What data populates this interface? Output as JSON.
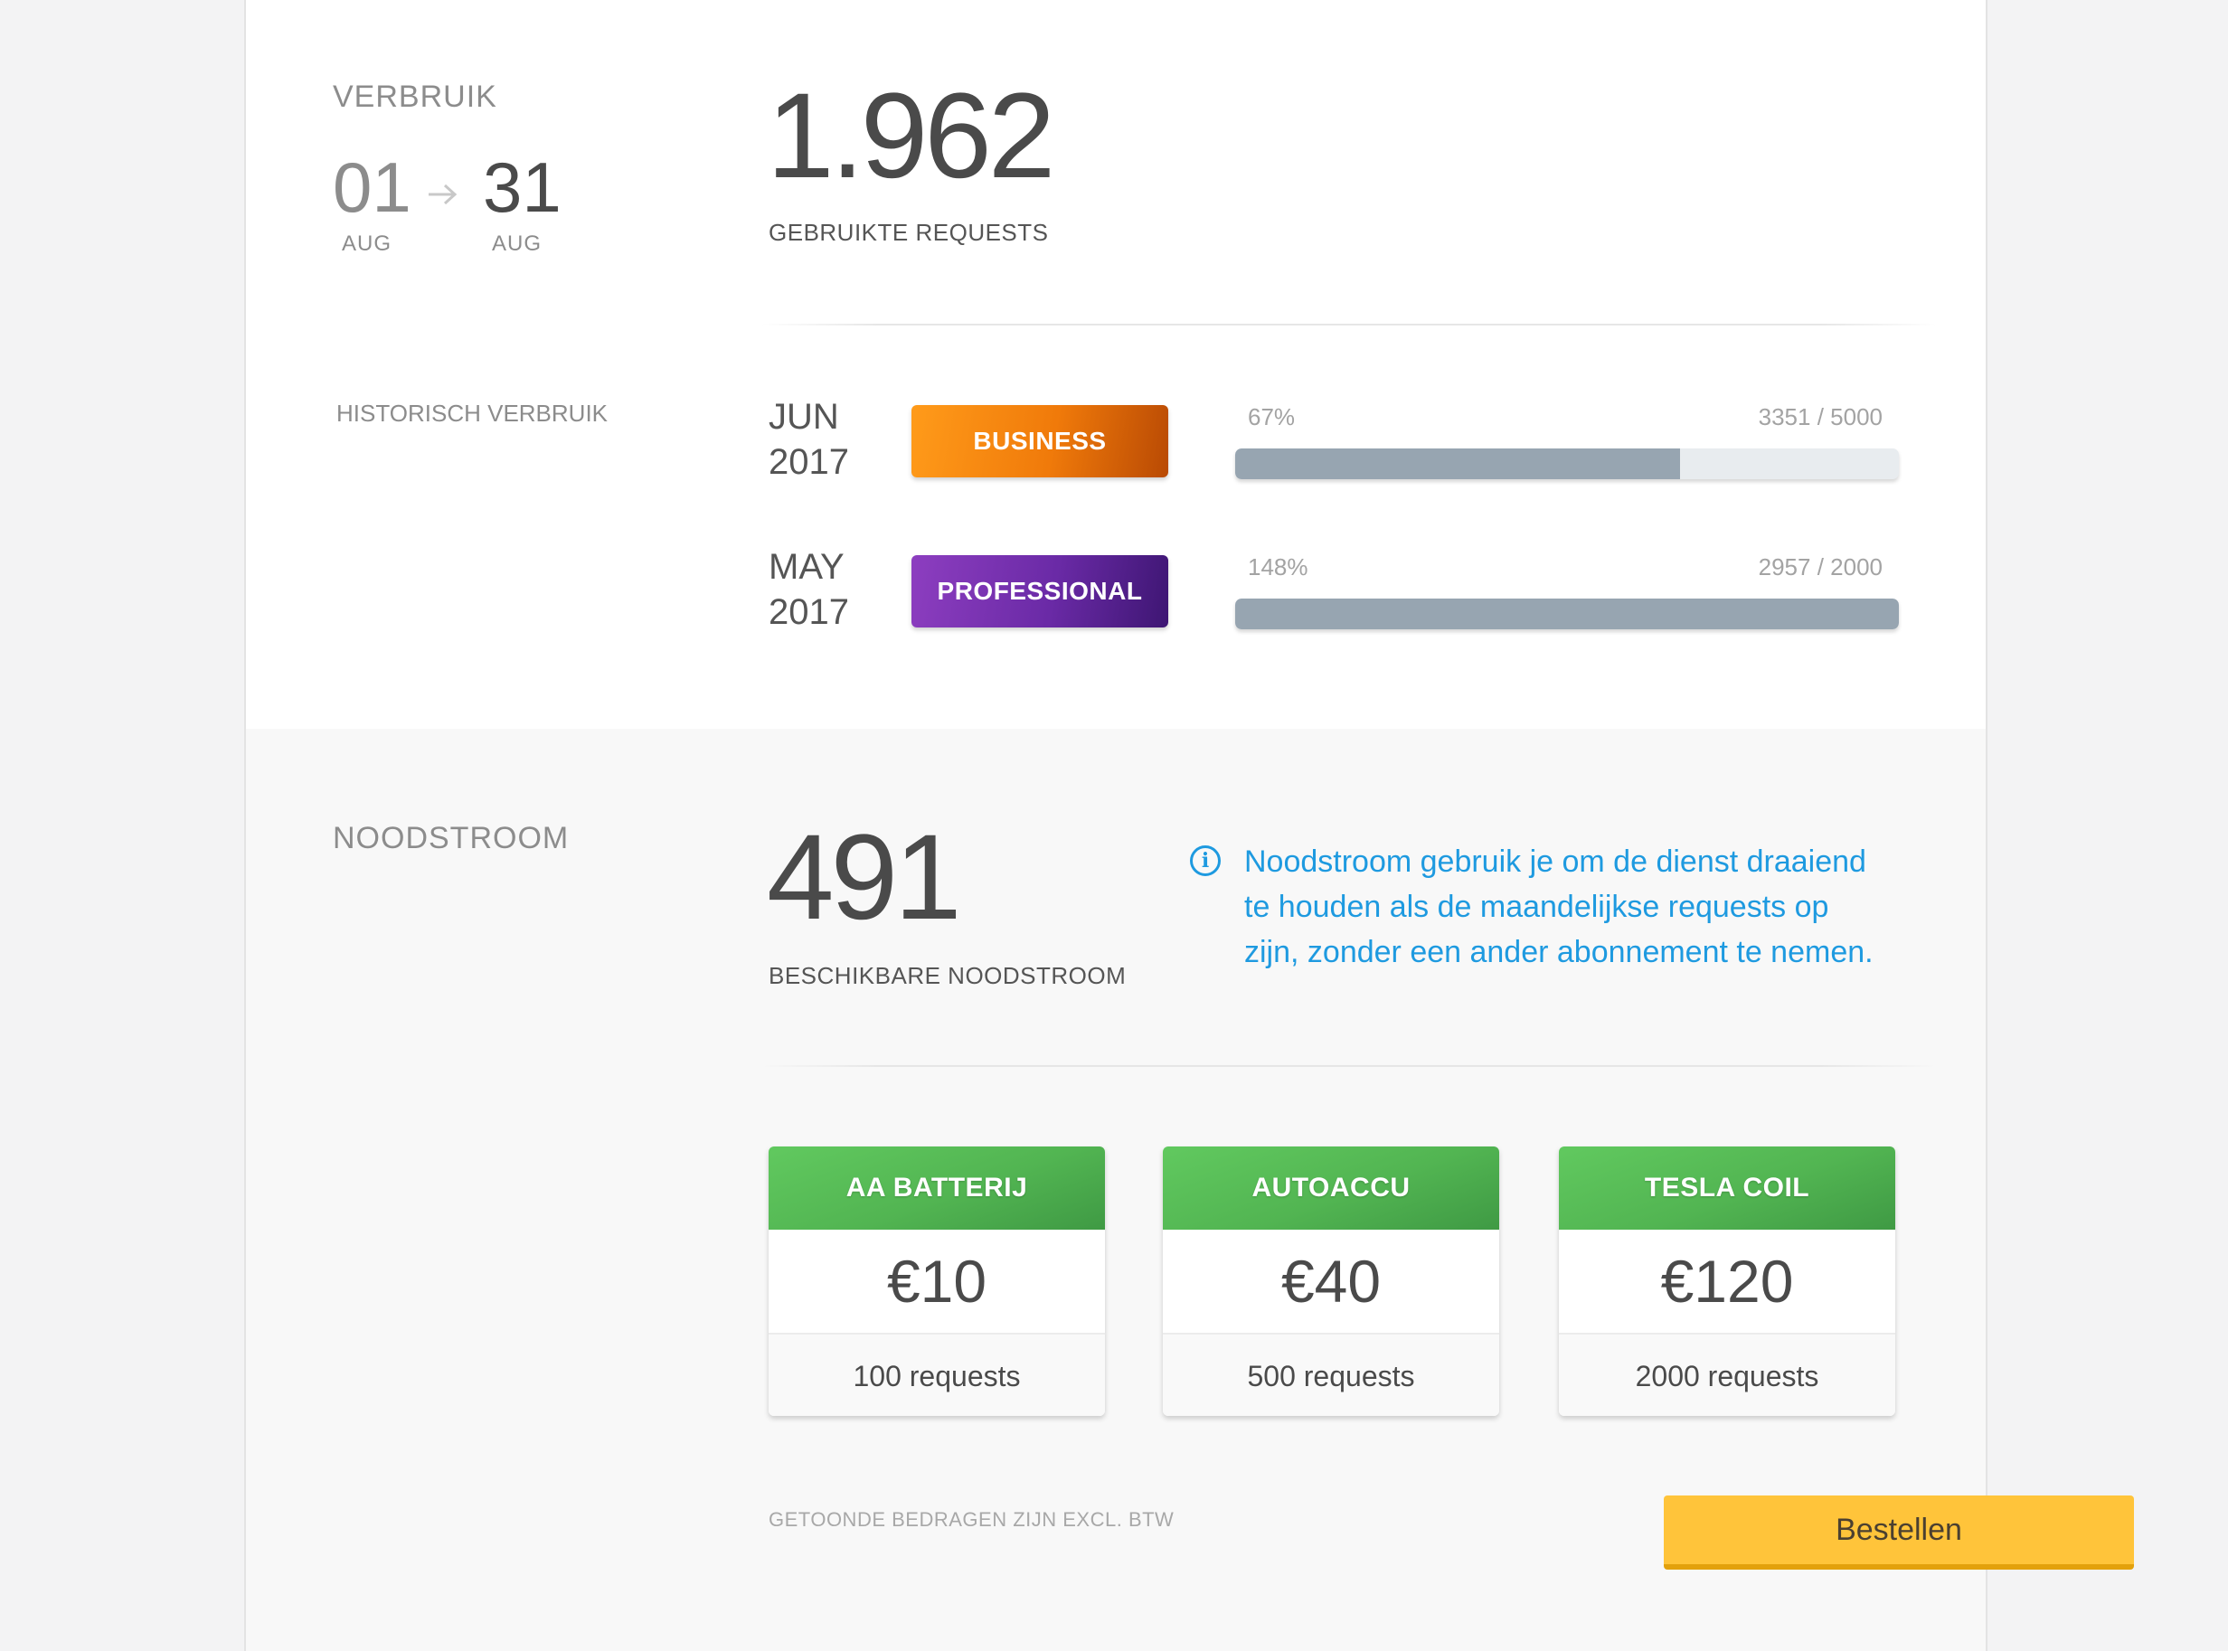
{
  "usage": {
    "section_title": "VERBRUIK",
    "period": {
      "start_day": "01",
      "start_month": "AUG",
      "end_day": "31",
      "end_month": "AUG"
    },
    "requests_used": "1.962",
    "requests_used_label": "GEBRUIKTE REQUESTS"
  },
  "history": {
    "section_title": "HISTORISCH VERBRUIK",
    "rows": [
      {
        "month": "JUN",
        "year": "2017",
        "tier": "BUSINESS",
        "percent_label": "67%",
        "count_label": "3351 / 5000",
        "fill_fraction": 0.67
      },
      {
        "month": "MAY",
        "year": "2017",
        "tier": "PROFESSIONAL",
        "percent_label": "148%",
        "count_label": "2957 / 2000",
        "fill_fraction": 1.0
      }
    ]
  },
  "emergency": {
    "section_title": "NOODSTROOM",
    "available": "491",
    "available_label": "BESCHIKBARE NOODSTROOM",
    "info_lines": [
      "Noodstroom gebruik je om de dienst draaiend",
      "te houden als de maandelijkse requests op",
      "zijn, zonder een ander abonnement te nemen."
    ],
    "packages": [
      {
        "name": "AA BATTERIJ",
        "price": "€10",
        "requests": "100 requests"
      },
      {
        "name": "AUTOACCU",
        "price": "€40",
        "requests": "500 requests"
      },
      {
        "name": "TESLA COIL",
        "price": "€120",
        "requests": "2000 requests"
      }
    ],
    "vat_note": "GETOONDE BEDRAGEN ZIJN EXCL. BTW",
    "order_button": "Bestellen"
  },
  "colors": {
    "business": "#f07a0a",
    "professional": "#6a2aa6",
    "package_header": "#52b552",
    "info": "#1e9ae0",
    "order_button": "#ffc43a",
    "bar_fill": "#97a5b1"
  }
}
